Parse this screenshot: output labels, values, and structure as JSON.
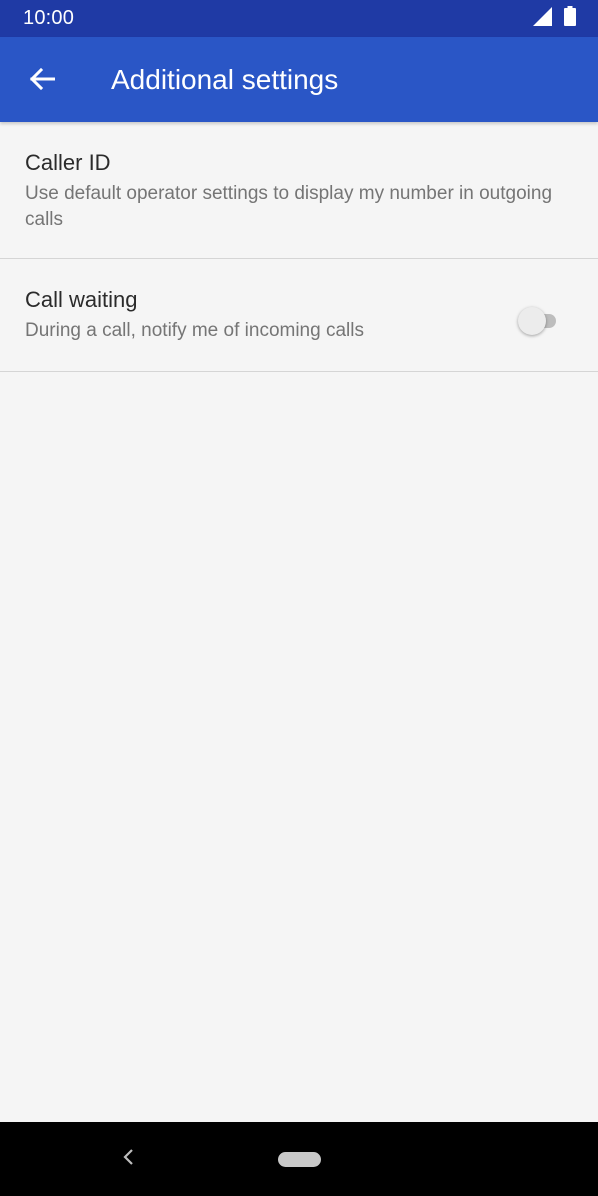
{
  "status_bar": {
    "time": "10:00",
    "icons": [
      "signal-icon",
      "battery-icon"
    ]
  },
  "app_bar": {
    "title": "Additional settings",
    "back_icon": "arrow-back-icon",
    "color": "#2a56c6"
  },
  "settings": [
    {
      "title": "Caller ID",
      "summary": "Use default operator settings to display my number in outgoing calls"
    },
    {
      "title": "Call waiting",
      "summary": "During a call, notify me of incoming calls",
      "toggle_on": false
    }
  ],
  "nav_bar": {
    "icons": [
      "nav-back-icon",
      "home-pill-icon"
    ]
  }
}
